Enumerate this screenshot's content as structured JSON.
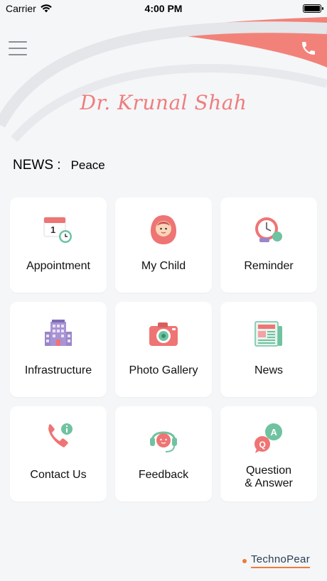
{
  "status_bar": {
    "carrier": "Carrier",
    "time": "4:00 PM"
  },
  "header": {
    "brand": "Dr. Krunal Shah"
  },
  "news": {
    "label": "NEWS :",
    "text": "Peace"
  },
  "tiles": [
    {
      "label": "Appointment"
    },
    {
      "label": "My Child"
    },
    {
      "label": "Reminder"
    },
    {
      "label": "Infrastructure"
    },
    {
      "label": "Photo Gallery"
    },
    {
      "label": "News"
    },
    {
      "label": "Contact Us"
    },
    {
      "label": "Feedback"
    },
    {
      "label_line1": "Question",
      "label_line2": "& Answer"
    }
  ],
  "footer": {
    "brand": "TechnoPear"
  },
  "colors": {
    "accent": "#f07d7d",
    "background": "#f5f6f8",
    "footer_accent": "#f07a3c"
  }
}
